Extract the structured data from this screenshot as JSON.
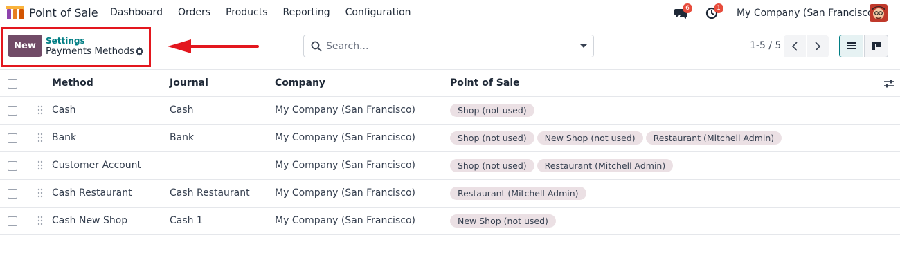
{
  "app": {
    "name": "Point of Sale",
    "icon": "pos-logo-icon"
  },
  "menu": [
    "Dashboard",
    "Orders",
    "Products",
    "Reporting",
    "Configuration"
  ],
  "systray": {
    "messages_badge": "6",
    "activities_badge": "1",
    "company": "My Company (San Francisco)"
  },
  "control": {
    "new_label": "New",
    "breadcrumb_parent": "Settings",
    "breadcrumb_current": "Payments Methods"
  },
  "search": {
    "placeholder": "Search..."
  },
  "pager": {
    "value": "1-5 / 5"
  },
  "table": {
    "columns": [
      "Method",
      "Journal",
      "Company",
      "Point of Sale"
    ],
    "rows": [
      {
        "method": "Cash",
        "journal": "Cash",
        "company": "My Company (San Francisco)",
        "pos": [
          "Shop (not used)"
        ]
      },
      {
        "method": "Bank",
        "journal": "Bank",
        "company": "My Company (San Francisco)",
        "pos": [
          "Shop (not used)",
          "New Shop (not used)",
          "Restaurant (Mitchell Admin)"
        ]
      },
      {
        "method": "Customer Account",
        "journal": "",
        "company": "My Company (San Francisco)",
        "pos": [
          "Shop (not used)",
          "Restaurant (Mitchell Admin)"
        ]
      },
      {
        "method": "Cash Restaurant",
        "journal": "Cash Restaurant",
        "company": "My Company (San Francisco)",
        "pos": [
          "Restaurant (Mitchell Admin)"
        ]
      },
      {
        "method": "Cash New Shop",
        "journal": "Cash 1",
        "company": "My Company (San Francisco)",
        "pos": [
          "New Shop (not used)"
        ]
      }
    ]
  },
  "colors": {
    "primary": "#714b67",
    "accent": "#017e84",
    "highlight": "#e3171e",
    "tag_bg": "#ebe0e4"
  }
}
